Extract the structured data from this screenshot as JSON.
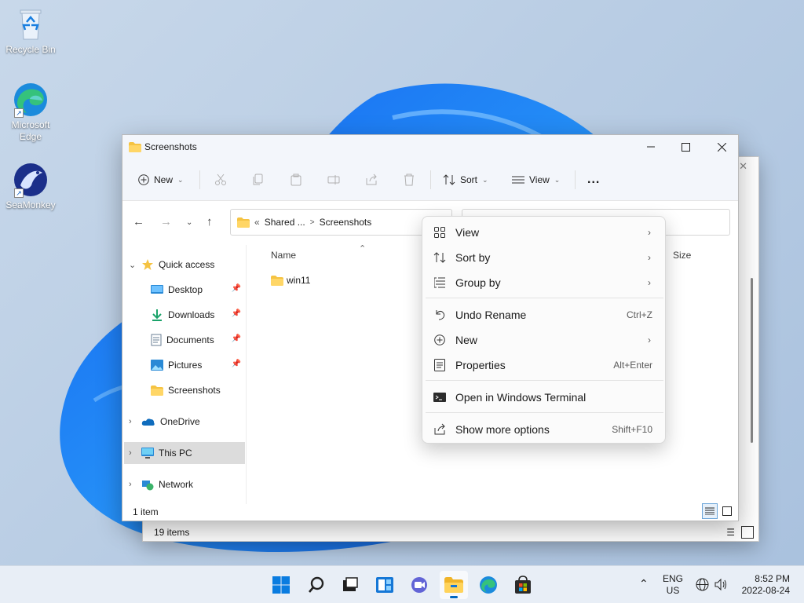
{
  "desktop": {
    "icons": [
      {
        "label": "Recycle Bin",
        "icon": "recycle-bin-icon"
      },
      {
        "label": "Microsoft Edge",
        "icon": "edge-icon"
      },
      {
        "label": "SeaMonkey",
        "icon": "seamonkey-icon"
      }
    ]
  },
  "bg_window": {
    "status": "19 items"
  },
  "window": {
    "title": "Screenshots",
    "toolbar": {
      "new": "New",
      "sort": "Sort",
      "view": "View",
      "more": "..."
    },
    "address": {
      "prefix": "«",
      "part1": "Shared ...",
      "sep": ">",
      "part2": "Screenshots"
    },
    "sidebar": {
      "quick_access": "Quick access",
      "items": [
        "Desktop",
        "Downloads",
        "Documents",
        "Pictures",
        "Screenshots"
      ],
      "onedrive": "OneDrive",
      "this_pc": "This PC",
      "network": "Network"
    },
    "columns": {
      "name": "Name",
      "size": "Size"
    },
    "files": [
      {
        "name": "win11",
        "type": "folder"
      }
    ],
    "status": "1 item"
  },
  "context_menu": {
    "items": [
      {
        "label": "View",
        "icon": "grid-icon",
        "submenu": true
      },
      {
        "label": "Sort by",
        "icon": "sort-icon",
        "submenu": true
      },
      {
        "label": "Group by",
        "icon": "group-icon",
        "submenu": true
      },
      {
        "label": "Undo Rename",
        "icon": "undo-icon",
        "shortcut": "Ctrl+Z"
      },
      {
        "label": "New",
        "icon": "plus-circle-icon",
        "submenu": true
      },
      {
        "label": "Properties",
        "icon": "properties-icon",
        "shortcut": "Alt+Enter"
      },
      {
        "label": "Open in Windows Terminal",
        "icon": "terminal-icon"
      },
      {
        "label": "Show more options",
        "icon": "share-icon",
        "shortcut": "Shift+F10"
      }
    ]
  },
  "taskbar": {
    "lang1": "ENG",
    "lang2": "US",
    "time": "8:52 PM",
    "date": "2022-08-24",
    "apps": [
      "start-icon",
      "search-icon",
      "task-view-icon",
      "widgets-icon",
      "chat-icon",
      "file-explorer-icon",
      "edge-icon",
      "store-icon"
    ]
  },
  "colors": {
    "accent": "#0067c0",
    "folder": "#f5c342",
    "menu_bg": "#fbfbfb"
  }
}
